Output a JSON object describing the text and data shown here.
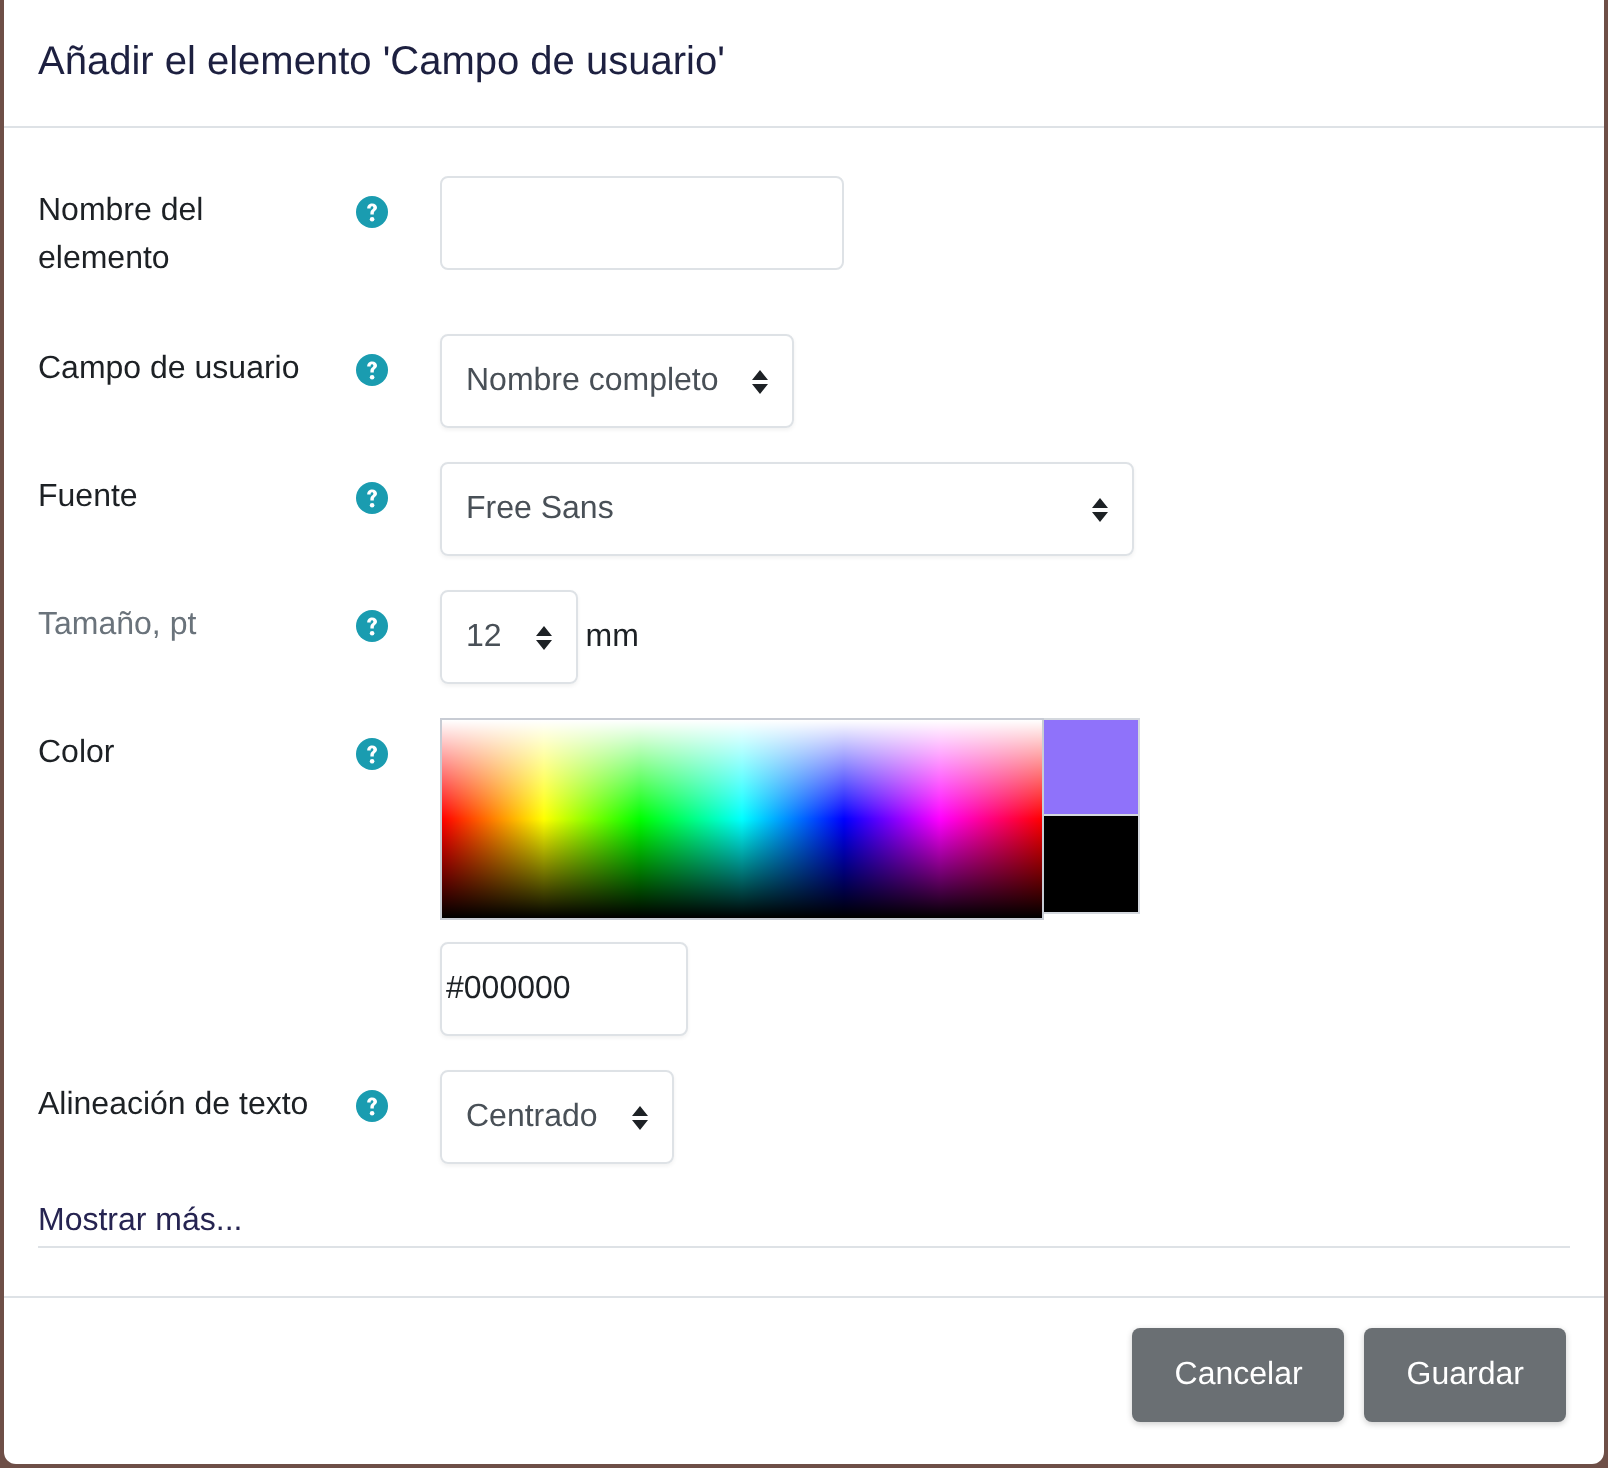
{
  "dialog": {
    "title": "Añadir el elemento 'Campo de usuario'"
  },
  "fields": [
    {
      "kind": "text",
      "label": "Nombre del elemento",
      "dimmed": false
    },
    {
      "kind": "select",
      "label": "Campo de usuario",
      "dimmed": false,
      "value": "Nombre completo"
    },
    {
      "kind": "select",
      "label": "Fuente",
      "dimmed": false,
      "value": "Free Sans"
    },
    {
      "kind": "select",
      "label": "Tamaño, pt",
      "dimmed": true,
      "value": "12",
      "unit": "mm"
    },
    {
      "kind": "color",
      "label": "Color",
      "dimmed": false,
      "value": "#000000",
      "swatches": [
        {
          "color": "#8f72fa"
        },
        {
          "color": "#000000"
        }
      ]
    },
    {
      "kind": "select",
      "label": "Alineación de texto",
      "dimmed": false,
      "value": "Centrado"
    }
  ],
  "more_link": "Mostrar más...",
  "buttons": [
    {
      "label": "Cancelar"
    },
    {
      "label": "Guardar"
    }
  ]
}
